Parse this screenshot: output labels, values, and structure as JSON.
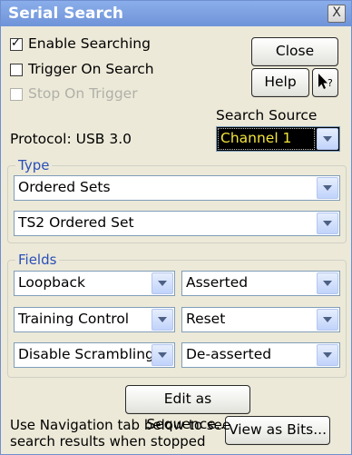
{
  "window": {
    "title": "Serial Search",
    "close_glyph": "X"
  },
  "options": {
    "enable_searching": {
      "label": "Enable Searching",
      "checked": true
    },
    "trigger_on_search": {
      "label": "Trigger On Search",
      "checked": false
    },
    "stop_on_trigger": {
      "label": "Stop On Trigger",
      "checked": false,
      "disabled": true
    }
  },
  "buttons": {
    "close": "Close",
    "help": "Help",
    "edit_sequence": "Edit as Sequence...",
    "view_bits": "View as Bits..."
  },
  "protocol": "Protocol: USB 3.0",
  "search_source": {
    "label": "Search Source",
    "value": "Channel 1"
  },
  "type_group": {
    "title": "Type",
    "type_value": "Ordered Sets",
    "subtype_value": "TS2 Ordered Set"
  },
  "fields_group": {
    "title": "Fields",
    "rows": [
      {
        "field": "Loopback",
        "value": "Asserted"
      },
      {
        "field": "Training Control",
        "value": "Reset"
      },
      {
        "field": "Disable Scrambling",
        "value": "De-asserted"
      }
    ]
  },
  "footer_text": {
    "line1": "Use Navigation tab below to see",
    "line2": "search results when stopped"
  },
  "colors": {
    "title_bar": "#6f93d8",
    "group_title": "#2a4fb8",
    "dialog_bg": "#ece9d8",
    "source_text": "#f2e43c"
  }
}
